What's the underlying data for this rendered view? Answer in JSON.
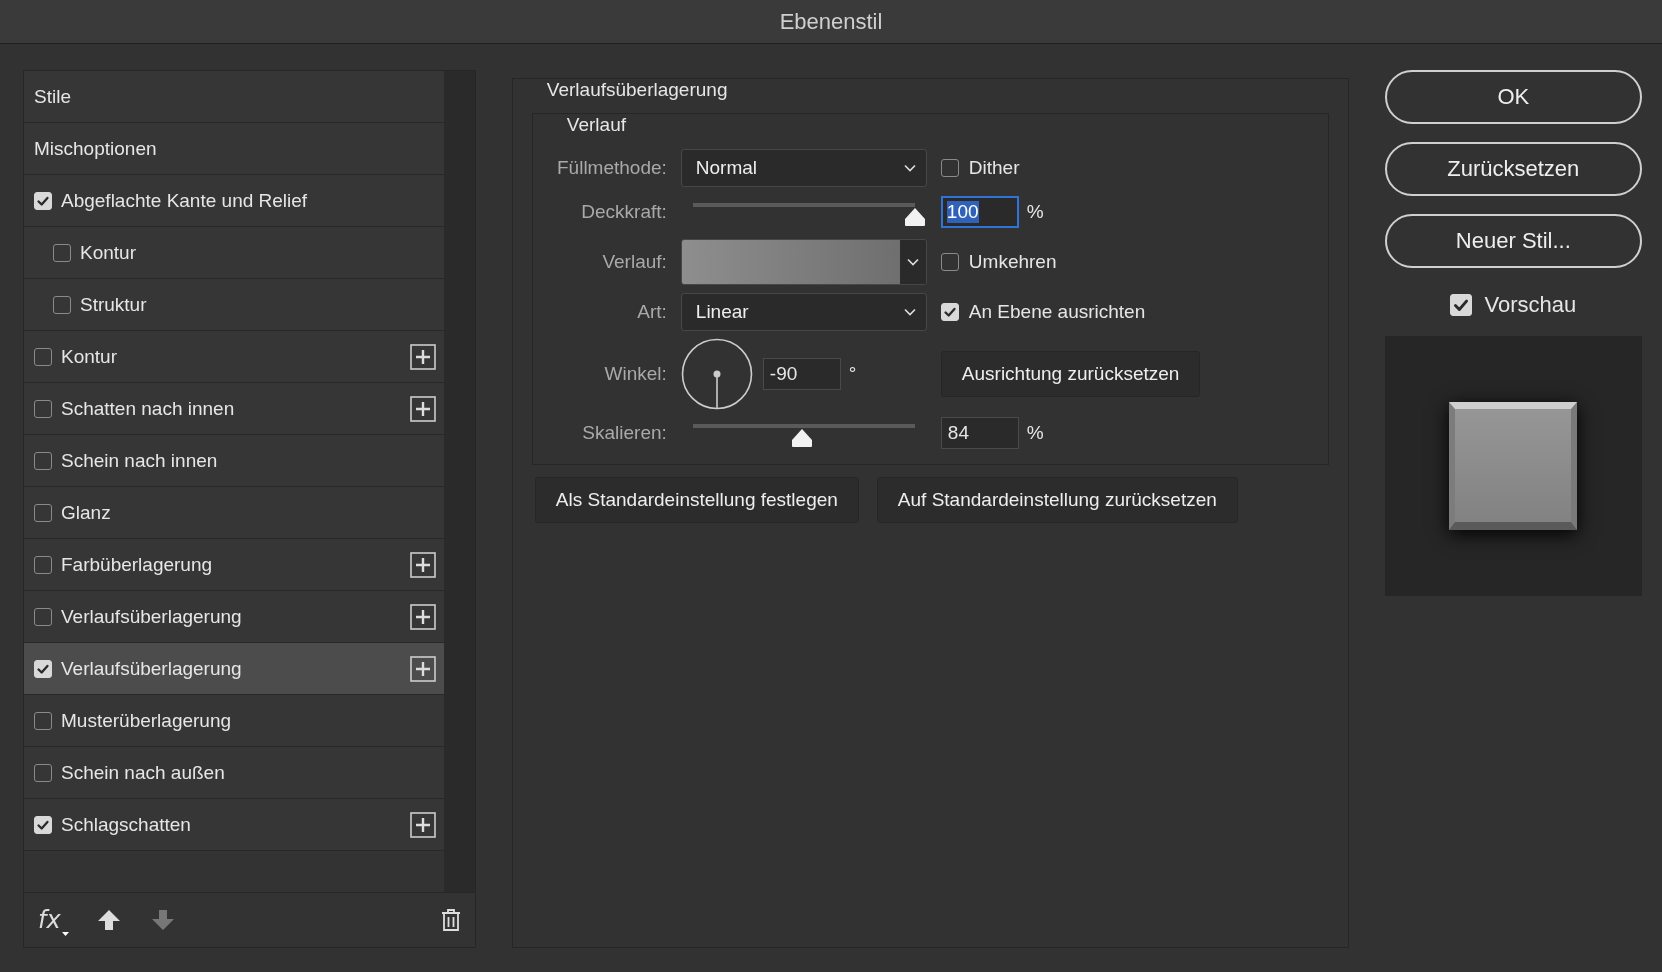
{
  "window": {
    "title": "Ebenenstil"
  },
  "styles": [
    {
      "label": "Stile",
      "kind": "header",
      "selected": false
    },
    {
      "label": "Mischoptionen",
      "kind": "header",
      "selected": false
    },
    {
      "label": "Abgeflachte Kante und Relief",
      "kind": "check",
      "checked": true,
      "addable": false,
      "selected": false,
      "children": [
        {
          "label": "Kontur",
          "kind": "check",
          "checked": false,
          "addable": false,
          "selected": false
        },
        {
          "label": "Struktur",
          "kind": "check",
          "checked": false,
          "addable": false,
          "selected": false
        }
      ]
    },
    {
      "label": "Kontur",
      "kind": "check",
      "checked": false,
      "addable": true,
      "selected": false
    },
    {
      "label": "Schatten nach innen",
      "kind": "check",
      "checked": false,
      "addable": true,
      "selected": false
    },
    {
      "label": "Schein nach innen",
      "kind": "check",
      "checked": false,
      "addable": false,
      "selected": false
    },
    {
      "label": "Glanz",
      "kind": "check",
      "checked": false,
      "addable": false,
      "selected": false
    },
    {
      "label": "Farbüberlagerung",
      "kind": "check",
      "checked": false,
      "addable": true,
      "selected": false
    },
    {
      "label": "Verlaufsüberlagerung",
      "kind": "check",
      "checked": false,
      "addable": true,
      "selected": false
    },
    {
      "label": "Verlaufsüberlagerung",
      "kind": "check",
      "checked": true,
      "addable": true,
      "selected": true
    },
    {
      "label": "Musterüberlagerung",
      "kind": "check",
      "checked": false,
      "addable": false,
      "selected": false
    },
    {
      "label": "Schein nach außen",
      "kind": "check",
      "checked": false,
      "addable": false,
      "selected": false
    },
    {
      "label": "Schlagschatten",
      "kind": "check",
      "checked": true,
      "addable": true,
      "selected": false
    }
  ],
  "footer": {
    "fx_label": "fx",
    "move_up_disabled": false,
    "move_down_disabled": true
  },
  "gradient_overlay": {
    "title": "Verlaufsüberlagerung",
    "section": "Verlauf",
    "blend_mode": {
      "label": "Füllmethode:",
      "value": "Normal"
    },
    "dither": {
      "label": "Dither",
      "checked": false
    },
    "opacity": {
      "label": "Deckkraft:",
      "level": 1,
      "value": "100",
      "unit": "%",
      "text_selected": true
    },
    "gradient": {
      "label": "Verlauf:"
    },
    "reverse": {
      "label": "Umkehren",
      "checked": false
    },
    "style": {
      "label": "Art:",
      "value": "Linear"
    },
    "align": {
      "label": "An Ebene ausrichten",
      "checked": true
    },
    "angle": {
      "label": "Winkel:",
      "value": "-90",
      "unit": "°"
    },
    "reset_alignment": "Ausrichtung zurücksetzen",
    "scale": {
      "label": "Skalieren:",
      "level": 0.49,
      "value": "84",
      "unit": "%",
      "text_selected": false
    }
  },
  "default_buttons": [
    "Als Standardeinstellung festlegen",
    "Auf Standardeinstellung zurücksetzen"
  ],
  "actions": [
    "OK",
    "Zurücksetzen",
    "Neuer Stil..."
  ],
  "preview": {
    "label": "Vorschau",
    "checked": true
  }
}
